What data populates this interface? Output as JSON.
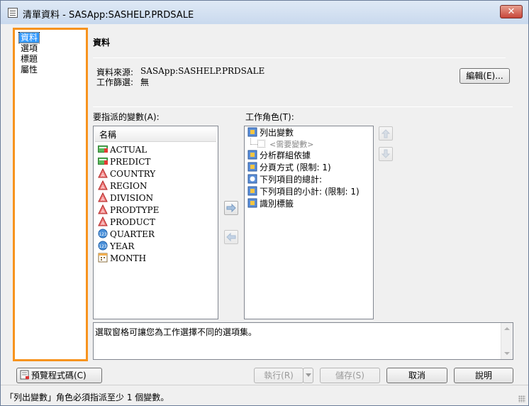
{
  "window": {
    "title": "清單資料 - SASApp:SASHELP.PRDSALE",
    "close_label": "✕"
  },
  "nav": {
    "items": [
      {
        "label": "資料",
        "selected": true
      },
      {
        "label": "選項",
        "selected": false
      },
      {
        "label": "標題",
        "selected": false
      },
      {
        "label": "屬性",
        "selected": false
      }
    ]
  },
  "data_panel": {
    "heading": "資料",
    "source_label": "資料來源:",
    "source_value": "SASApp:SASHELP.PRDSALE",
    "filter_label": "工作篩選:",
    "filter_value": "無",
    "edit_button": "編輯(E)..."
  },
  "variables": {
    "label": "要指派的變數(A):",
    "column_header": "名稱",
    "items": [
      {
        "name": "ACTUAL",
        "icon": "numeric-currency-icon"
      },
      {
        "name": "PREDICT",
        "icon": "numeric-currency-icon"
      },
      {
        "name": "COUNTRY",
        "icon": "character-icon"
      },
      {
        "name": "REGION",
        "icon": "character-icon"
      },
      {
        "name": "DIVISION",
        "icon": "character-icon"
      },
      {
        "name": "PRODTYPE",
        "icon": "character-icon"
      },
      {
        "name": "PRODUCT",
        "icon": "character-icon"
      },
      {
        "name": "QUARTER",
        "icon": "numeric-icon"
      },
      {
        "name": "YEAR",
        "icon": "numeric-icon"
      },
      {
        "name": "MONTH",
        "icon": "date-icon"
      }
    ]
  },
  "roles": {
    "label": "工作角色(T):",
    "items": [
      {
        "label": "列出變數",
        "icon": "role-icon"
      },
      {
        "label": "<需要變數>",
        "icon": "placeholder",
        "sub": true
      },
      {
        "label": "分析群組依據",
        "icon": "role-icon"
      },
      {
        "label": "分頁方式 (限制: 1)",
        "icon": "role-icon"
      },
      {
        "label": "下列項目的總計:",
        "icon": "numeric-role-icon"
      },
      {
        "label": "下列項目的小計: (限制: 1)",
        "icon": "role-icon"
      },
      {
        "label": "識別標籤",
        "icon": "role-icon"
      }
    ]
  },
  "description": "選取窗格可讓您為工作選擇不同的選項集。",
  "buttons": {
    "preview_code": "預覽程式碼(C)",
    "run": "執行(R)",
    "save": "儲存(S)",
    "cancel": "取消",
    "help": "說明"
  },
  "status": "「列出變數」角色必須指派至少 1 個變數。",
  "colors": {
    "nav_border": "#f7931e",
    "selection": "#3399ff"
  }
}
